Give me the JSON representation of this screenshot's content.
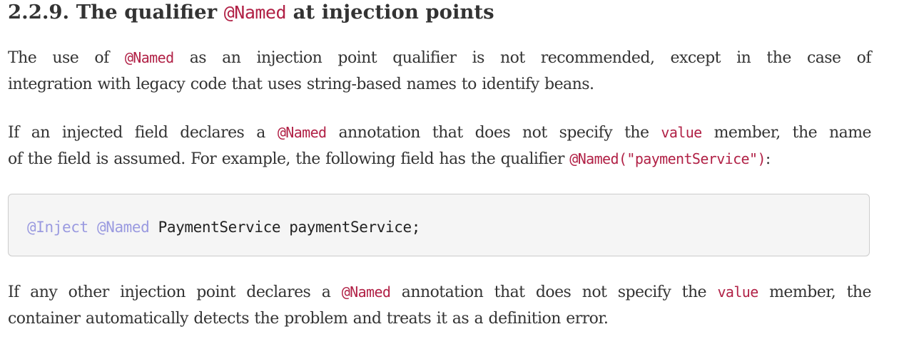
{
  "section": {
    "heading_prefix": "2.2.9. The qualifier ",
    "heading_code": "@Named",
    "heading_suffix": " at injection points"
  },
  "paragraph1": {
    "line1_a": "The use of ",
    "line1_code": "@Named",
    "line1_b": " as an injection point qualifier is not recommended, except in the case of",
    "line2": "integration with legacy code that uses string-based names to identify beans."
  },
  "paragraph2": {
    "line1_a": "If an injected field declares a ",
    "line1_code1": "@Named",
    "line1_b": " annotation that does not specify the ",
    "line1_code2": "value",
    "line1_c": " member, the name",
    "line2_a": "of the field is assumed. For example, the following field has the qualifier ",
    "line2_code": "@Named(\"paymentService\")",
    "line2_b": ":"
  },
  "code_example": {
    "anno1": "@Inject",
    "anno2": "@Named",
    "rest": " PaymentService paymentService;"
  },
  "paragraph3": {
    "line1_a": "If any other injection point declares a ",
    "line1_code1": "@Named",
    "line1_b": " annotation that does not specify the ",
    "line1_code2": "value",
    "line1_c": " member, the",
    "line2": "container automatically detects the problem and treats it as a definition error."
  },
  "colors": {
    "text": "#333333",
    "inline_code": "#b12146",
    "annotation": "#9a9ae0",
    "code_background": "#f5f5f5",
    "code_border": "#cccccc"
  }
}
